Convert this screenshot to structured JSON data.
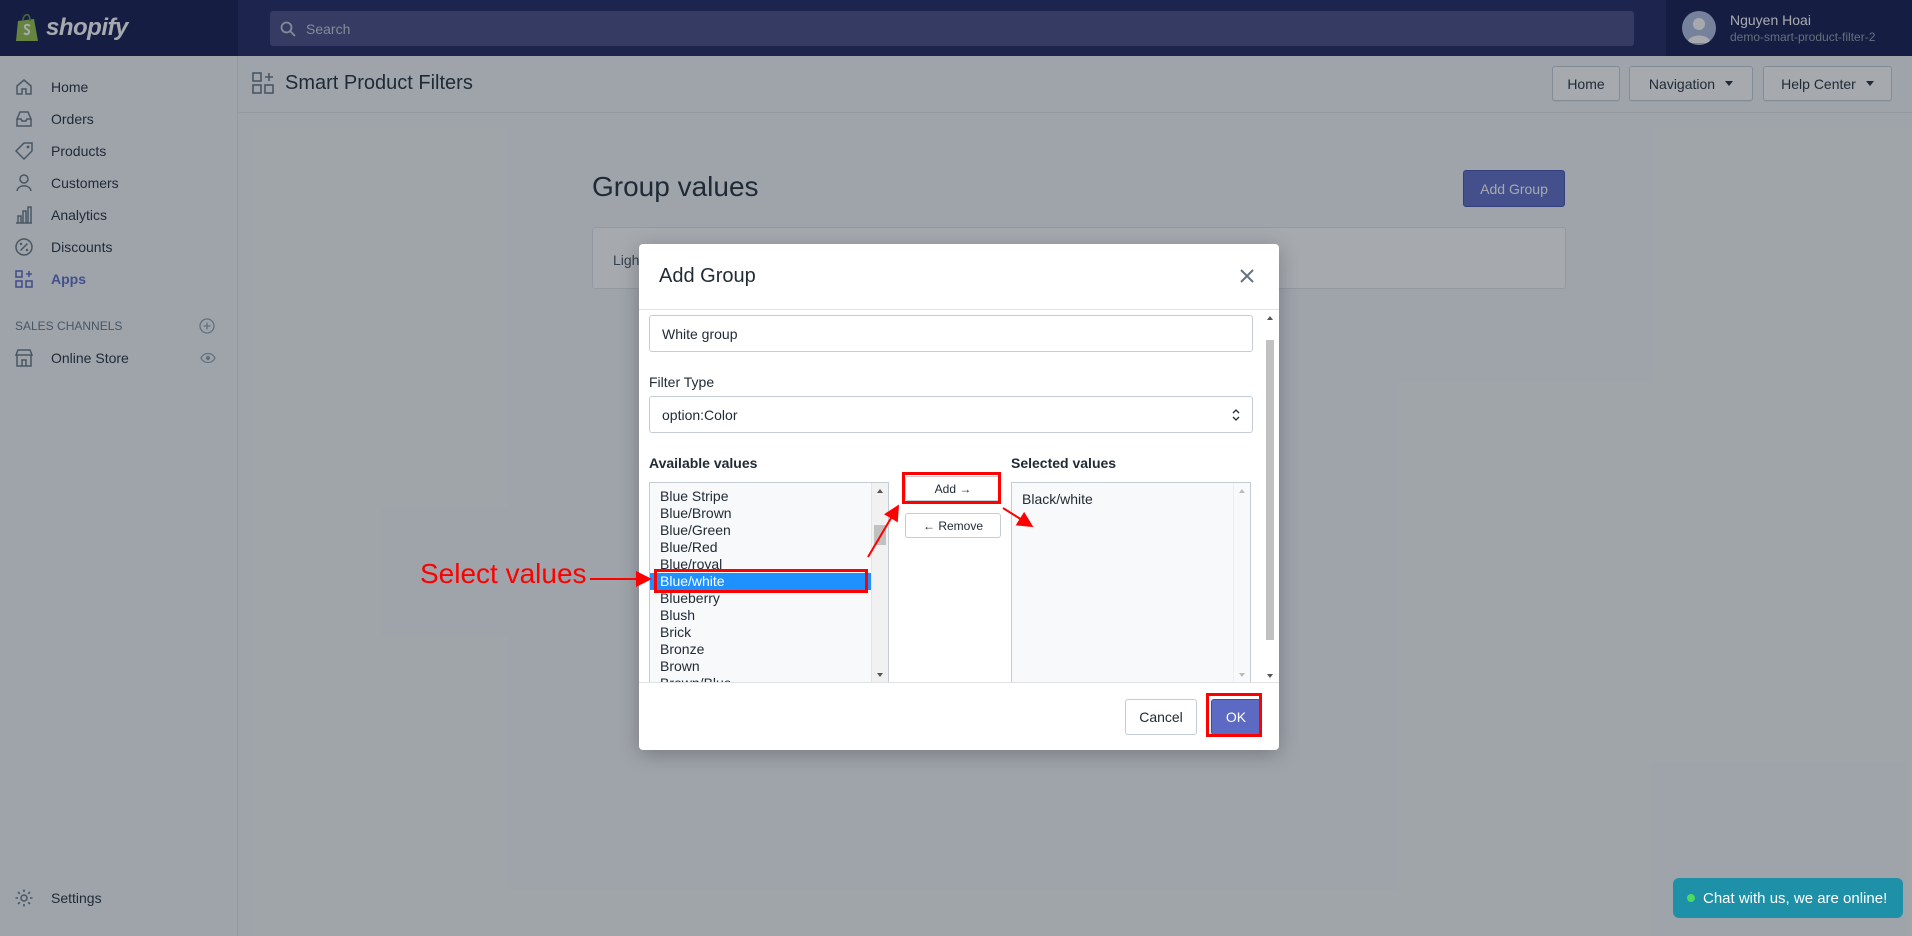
{
  "brand": {
    "name": "shopify"
  },
  "search": {
    "placeholder": "Search"
  },
  "user": {
    "name": "Nguyen Hoai",
    "store": "demo-smart-product-filter-2"
  },
  "sidebar": {
    "items": [
      {
        "label": "Home",
        "icon": "home-icon"
      },
      {
        "label": "Orders",
        "icon": "orders-icon"
      },
      {
        "label": "Products",
        "icon": "tag-icon"
      },
      {
        "label": "Customers",
        "icon": "person-icon"
      },
      {
        "label": "Analytics",
        "icon": "bar-chart-icon"
      },
      {
        "label": "Discounts",
        "icon": "discount-icon"
      },
      {
        "label": "Apps",
        "icon": "apps-icon",
        "active": true
      }
    ],
    "sales_channels_label": "SALES CHANNELS",
    "online_store_label": "Online Store",
    "settings_label": "Settings"
  },
  "app": {
    "title": "Smart Product Filters",
    "buttons": {
      "home": "Home",
      "navigation": "Navigation",
      "help": "Help Center"
    }
  },
  "page": {
    "title": "Group values",
    "add_group_label": "Add Group",
    "card_text": "Ligh"
  },
  "modal": {
    "title": "Add Group",
    "group_name_value": "White group",
    "filter_type_label": "Filter Type",
    "filter_type_value": "option:Color",
    "available_label": "Available values",
    "selected_label": "Selected values",
    "available_values": [
      "Blue Stripe",
      "Blue/Brown",
      "Blue/Green",
      "Blue/Red",
      "Blue/royal",
      "Blue/white",
      "Blueberry",
      "Blush",
      "Brick",
      "Bronze",
      "Brown",
      "Brown/Blue"
    ],
    "selected_available": "Blue/white",
    "selected_values": [
      "Black/white"
    ],
    "add_label": "Add →",
    "remove_label": "← Remove",
    "cancel_label": "Cancel",
    "ok_label": "OK"
  },
  "annotation": {
    "text": "Select values",
    "color": "#ff0000"
  },
  "chat": {
    "label": "Chat with us, we are online!"
  },
  "colors": {
    "topbar": "#1c2260",
    "accent": "#5c6ac4",
    "chat": "#1e90a8"
  }
}
